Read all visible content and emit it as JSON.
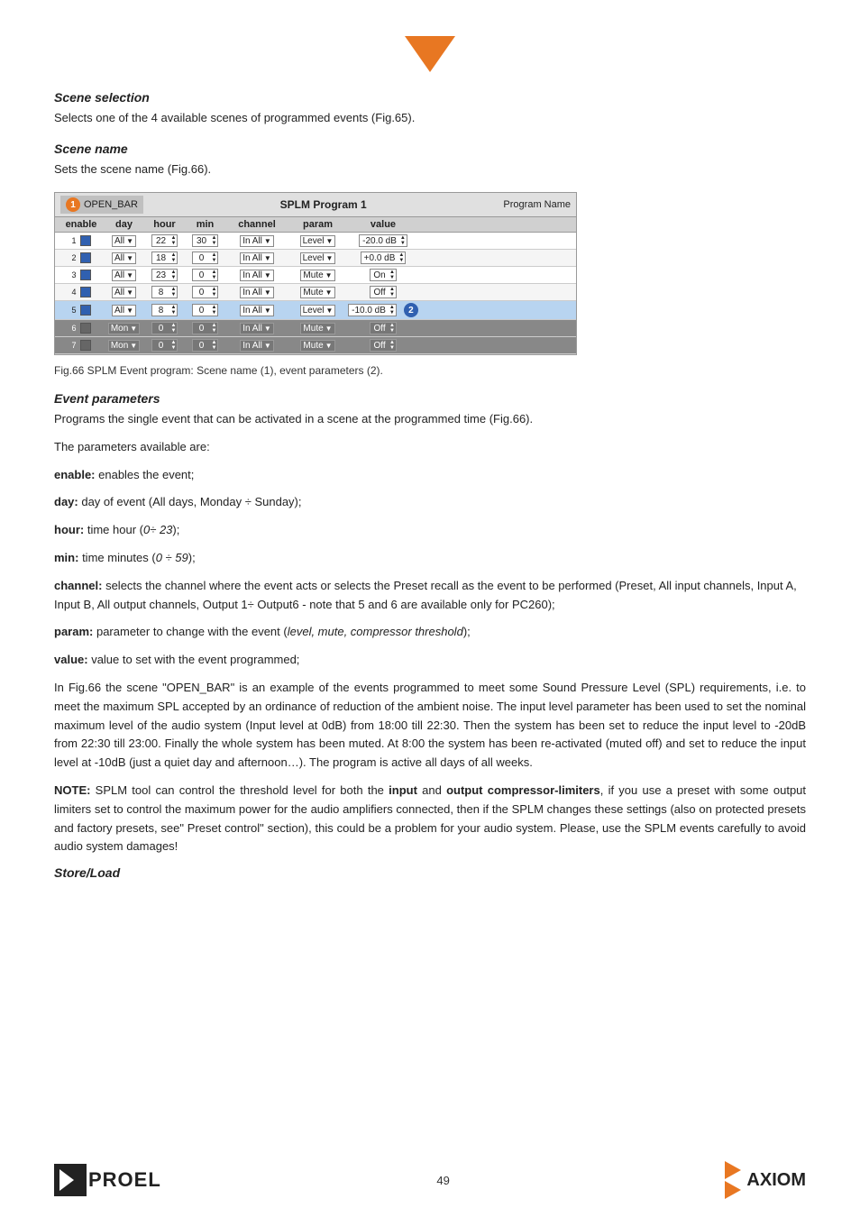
{
  "top_arrow": "▼",
  "sections": {
    "scene_selection": {
      "heading": "Scene selection",
      "text": "Selects one of the 4 available scenes of programmed events (Fig.65)."
    },
    "scene_name": {
      "heading": "Scene name",
      "text": "Sets the scene name (Fig.66)."
    }
  },
  "splm_table": {
    "title": "SPLM Program 1",
    "open_bar_label": "OPEN_BAR",
    "badge1": "1",
    "program_name_label": "Program Name",
    "columns": [
      "enable",
      "day",
      "hour",
      "min",
      "channel",
      "param",
      "value"
    ],
    "rows": [
      {
        "num": 1,
        "enable": true,
        "day": "All",
        "hour": "22",
        "min": "30",
        "channel": "In All",
        "param": "Level",
        "value": "-20.0 dB",
        "type": "normal"
      },
      {
        "num": 2,
        "enable": true,
        "day": "All",
        "hour": "18",
        "min": "0",
        "channel": "In All",
        "param": "Level",
        "value": "+0.0 dB",
        "type": "normal"
      },
      {
        "num": 3,
        "enable": true,
        "day": "All",
        "hour": "23",
        "min": "0",
        "channel": "In All",
        "param": "Mute",
        "value": "On",
        "type": "normal"
      },
      {
        "num": 4,
        "enable": true,
        "day": "All",
        "hour": "8",
        "min": "0",
        "channel": "In All",
        "param": "Mute",
        "value": "Off",
        "type": "normal"
      },
      {
        "num": 5,
        "enable": true,
        "day": "All",
        "hour": "8",
        "min": "0",
        "channel": "In All",
        "param": "Level",
        "value": "-10.0 dB",
        "type": "highlighted"
      },
      {
        "num": 6,
        "enable": false,
        "day": "Mon",
        "hour": "0",
        "min": "0",
        "channel": "In All",
        "param": "Mute",
        "value": "Off",
        "type": "dark"
      },
      {
        "num": 7,
        "enable": false,
        "day": "Mon",
        "hour": "0",
        "min": "0",
        "channel": "In All",
        "param": "Mute",
        "value": "Off",
        "type": "dark"
      }
    ],
    "badge2": "2"
  },
  "fig_caption": "Fig.66 SPLM Event program: Scene name (1), event parameters (2).",
  "event_parameters": {
    "heading": "Event parameters",
    "intro": "Programs the single event that can be activated in a scene at the programmed time (Fig.66).",
    "available": "The parameters available are:",
    "params": [
      {
        "bold": "enable:",
        "text": " enables the event;"
      },
      {
        "bold": "day:",
        "text": " day of event (All days, Monday ÷ Sunday);"
      },
      {
        "bold": "hour:",
        "text": " time hour (0÷ 23);"
      },
      {
        "bold": "min:",
        "text": " time minutes (0 ÷ 59);"
      },
      {
        "bold": "channel:",
        "text": " selects the channel where the event acts or selects the Preset recall as the event to be performed (Preset, All input channels, Input A, Input B, All output channels, Output 1÷ Output6 - note that 5 and 6 are available only for PC260);"
      },
      {
        "bold": "param:",
        "text": " parameter to change with the event (level, mute, compressor threshold);"
      },
      {
        "bold": "value:",
        "text": " value to set with the event programmed;"
      }
    ],
    "note_paragraph": "In Fig.66 the scene \"OPEN_BAR\" is an example of the events programmed to meet some Sound Pressure Level (SPL) requirements, i.e. to meet the maximum SPL accepted by an ordinance of reduction of the ambient noise. The input level parameter has been used to set the nominal maximum level of the audio system (Input level at 0dB) from 18:00 till 22:30. Then the system has been set to reduce the input level to -20dB from 22:30 till 23:00. Finally the whole system has been muted. At 8:00 the system has been re-activated (muted off) and set to reduce the input level at -10dB (just a quiet day and afternoon…). The program is active all days of all weeks.",
    "note_bold_prefix": "NOTE:",
    "note_text": " SPLM tool can control the threshold level for both the ",
    "note_input_bold": "input",
    "note_text2": " and ",
    "note_output_bold": "output compressor-limiters",
    "note_text3": ", if you use a preset with some output limiters set to control the maximum power for the audio amplifiers connected, then if the SPLM changes these settings (also on protected presets and factory presets, see\" Preset control\" section), this could be a problem for your audio system. Please, use the SPLM events carefully to avoid audio system damages!"
  },
  "store_load": {
    "heading": "Store/Load"
  },
  "footer": {
    "page_number": "49",
    "proel_text": "PROEL",
    "axiom_text": "AXIOM"
  }
}
